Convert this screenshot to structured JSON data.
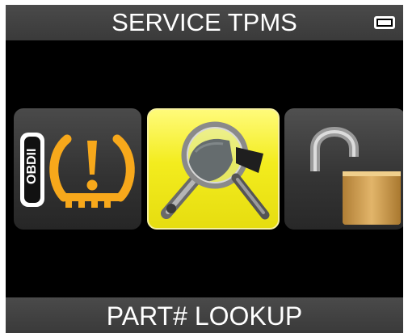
{
  "header": {
    "title": "SERVICE TPMS",
    "battery_icon": "battery-icon"
  },
  "tiles": [
    {
      "id": "obd",
      "badge_text": "OBDII",
      "icon": "tpms-warning-icon",
      "selected": false
    },
    {
      "id": "part-lookup",
      "icon": "sensor-magnifier-icon",
      "selected": true
    },
    {
      "id": "unlock",
      "icon": "padlock-open-icon",
      "selected": false
    }
  ],
  "footer": {
    "label": "PART# LOOKUP"
  },
  "colors": {
    "highlight": "#f3ec1e",
    "warning": "#f7a81b",
    "background": "#000000"
  }
}
